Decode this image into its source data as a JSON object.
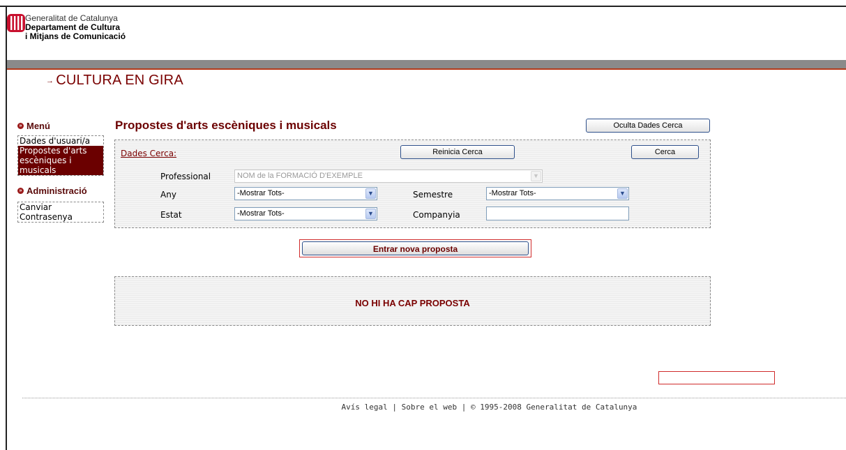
{
  "header": {
    "org_line1": "Generalitat de Catalunya",
    "org_line2": "Departament de Cultura",
    "org_line3": "i Mitjans de Comunicació",
    "site_title": "CULTURA EN GIRA",
    "arrow": "→"
  },
  "menu": {
    "menu_heading": "Menú",
    "menu_items": [
      {
        "label": "Dades d'usuari/a",
        "active": false
      },
      {
        "label": "Propostes d'arts escèniques i musicals",
        "active": true
      }
    ],
    "admin_heading": "Administració",
    "admin_items": [
      {
        "label": "Canviar Contrasenya"
      }
    ]
  },
  "main": {
    "page_title": "Propostes d'arts escèniques i musicals",
    "hide_search_button": "Oculta Dades Cerca",
    "search_legend": "Dades Cerca:",
    "reset_button": "Reinicia Cerca",
    "search_button": "Cerca",
    "fields": {
      "professional_label": "Professional",
      "professional_value": "NOM de la FORMACIÓ D'EXEMPLE",
      "any_label": "Any",
      "any_value": "-Mostrar Tots-",
      "semestre_label": "Semestre",
      "semestre_value": "-Mostrar Tots-",
      "estat_label": "Estat",
      "estat_value": "-Mostrar Tots-",
      "companyia_label": "Companyia",
      "companyia_value": ""
    },
    "new_proposal_button": "Entrar nova proposta",
    "empty_message": "NO HI HA CAP PROPOSTA"
  },
  "footer": {
    "legal": "Avís legal",
    "about": "Sobre el web",
    "separator": "|",
    "copyright": "© 1995-2008 Generalitat de Catalunya"
  },
  "colors": {
    "brand_red": "#7a0000",
    "menu_active_bg": "#6b0000",
    "grey_bar": "#8a8a8a"
  }
}
